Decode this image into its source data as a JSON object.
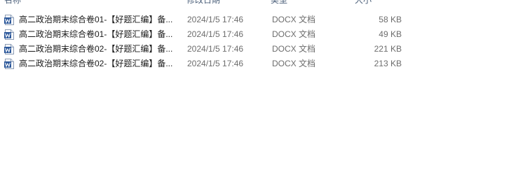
{
  "columns": {
    "name": "名称",
    "date": "修改日期",
    "type": "类型",
    "size": "大小"
  },
  "files": [
    {
      "icon": "word-doc-icon",
      "name": "高二政治期末综合卷01-【好题汇编】备...",
      "date": "2024/1/5 17:46",
      "type": "DOCX 文档",
      "size": "58 KB"
    },
    {
      "icon": "word-doc-icon",
      "name": "高二政治期末综合卷01-【好题汇编】备...",
      "date": "2024/1/5 17:46",
      "type": "DOCX 文档",
      "size": "49 KB"
    },
    {
      "icon": "word-doc-icon",
      "name": "高二政治期末综合卷02-【好题汇编】备...",
      "date": "2024/1/5 17:46",
      "type": "DOCX 文档",
      "size": "221 KB"
    },
    {
      "icon": "word-doc-icon",
      "name": "高二政治期末综合卷02-【好题汇编】备...",
      "date": "2024/1/5 17:46",
      "type": "DOCX 文档",
      "size": "213 KB"
    }
  ],
  "colors": {
    "word_blue": "#2b579a",
    "header_text": "#4c607a",
    "secondary_text": "#6d6d6d"
  }
}
